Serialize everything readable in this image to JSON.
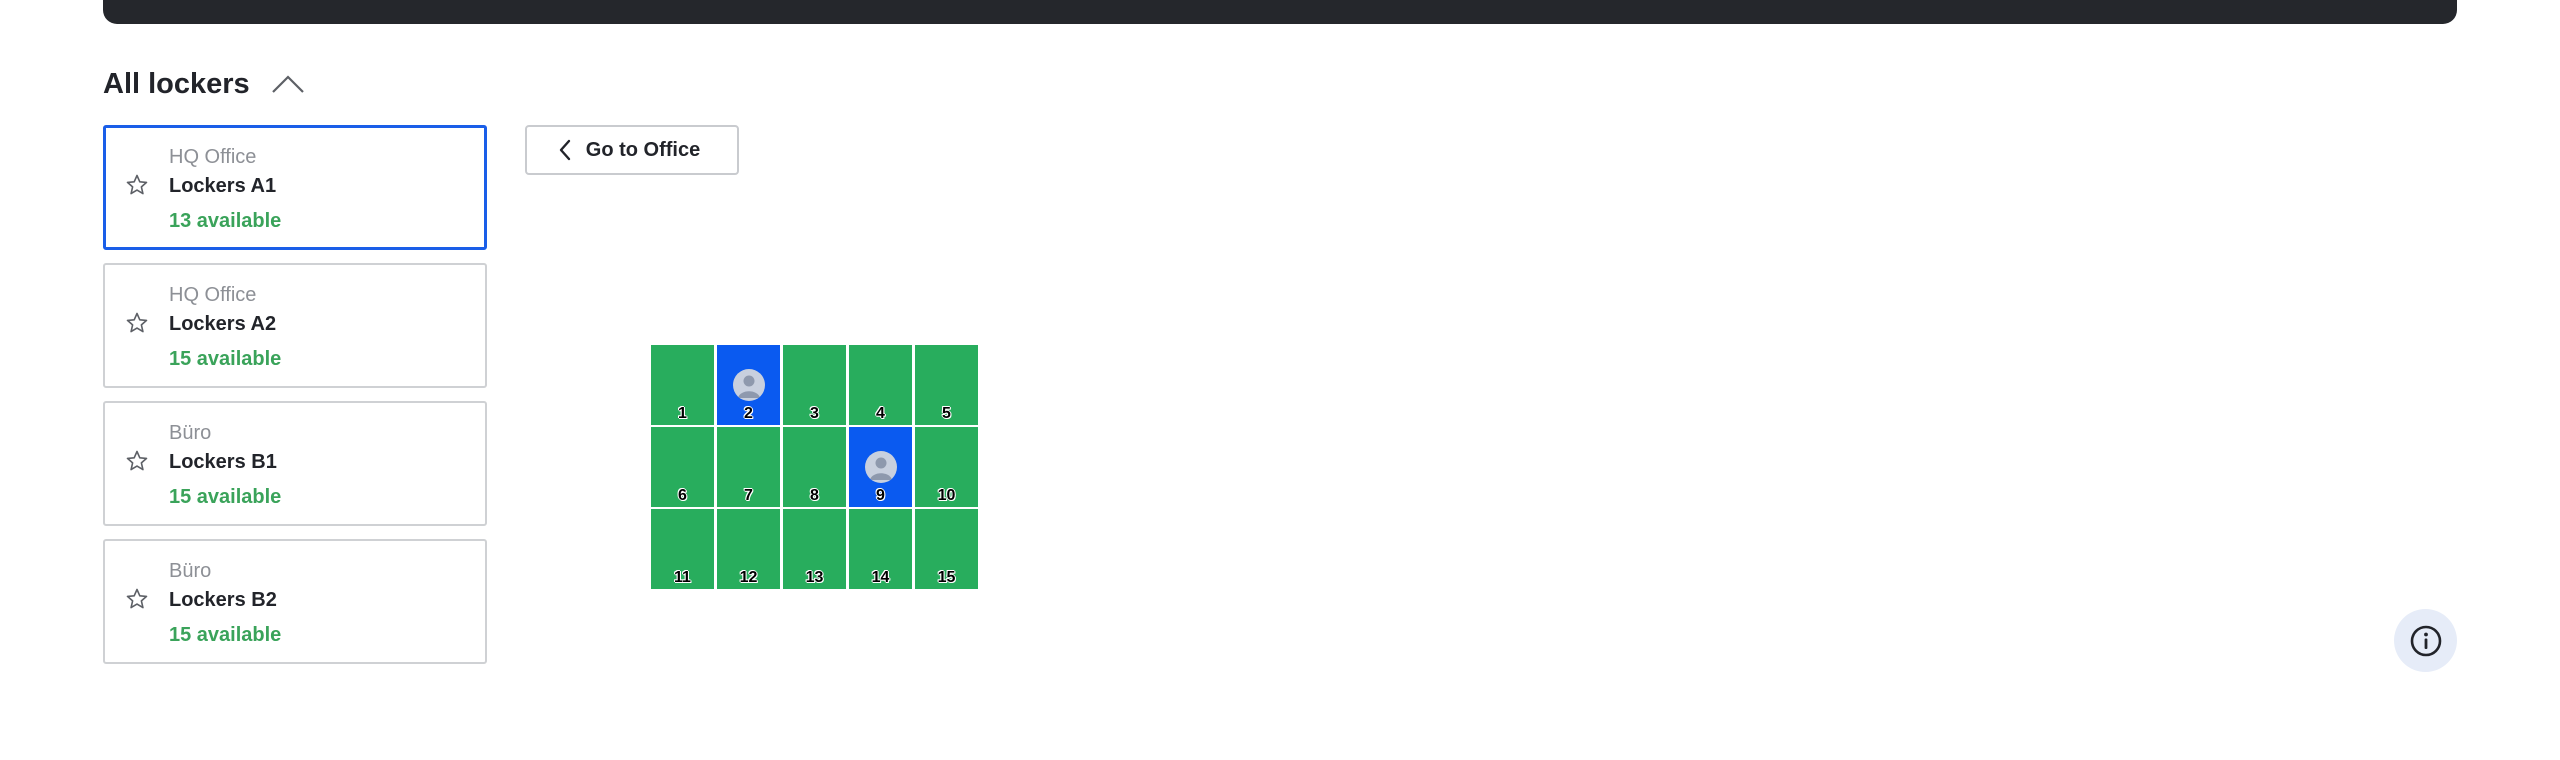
{
  "section": {
    "title": "All lockers",
    "toggle_icon": "chevron-up-icon"
  },
  "locker_groups": [
    {
      "office": "HQ Office",
      "name": "Lockers A1",
      "availability": "13 available",
      "selected": true
    },
    {
      "office": "HQ Office",
      "name": "Lockers A2",
      "availability": "15 available",
      "selected": false
    },
    {
      "office": "Büro",
      "name": "Lockers B1",
      "availability": "15 available",
      "selected": false
    },
    {
      "office": "Büro",
      "name": "Lockers B2",
      "availability": "15 available",
      "selected": false
    }
  ],
  "toolbar": {
    "go_to_office_label": "Go to Office",
    "go_to_office_icon": "chevron-left-icon"
  },
  "lockers": [
    {
      "number": "1",
      "status": "available"
    },
    {
      "number": "2",
      "status": "occupied"
    },
    {
      "number": "3",
      "status": "available"
    },
    {
      "number": "4",
      "status": "available"
    },
    {
      "number": "5",
      "status": "available"
    },
    {
      "number": "6",
      "status": "available"
    },
    {
      "number": "7",
      "status": "available"
    },
    {
      "number": "8",
      "status": "available"
    },
    {
      "number": "9",
      "status": "occupied"
    },
    {
      "number": "10",
      "status": "available"
    },
    {
      "number": "11",
      "status": "available"
    },
    {
      "number": "12",
      "status": "available"
    },
    {
      "number": "13",
      "status": "available"
    },
    {
      "number": "14",
      "status": "available"
    },
    {
      "number": "15",
      "status": "available"
    }
  ],
  "colors": {
    "available": "#28ad5d",
    "occupied": "#0a5af0",
    "selected_border": "#1a5ee8",
    "availability_text": "#3aa35a",
    "header_bar": "#25272c"
  },
  "info_button_icon": "info-icon"
}
